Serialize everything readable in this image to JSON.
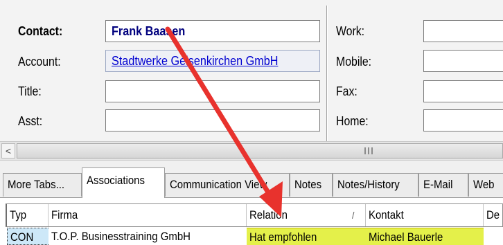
{
  "form": {
    "contact_label": "Contact:",
    "contact_value": "Frank Baasen",
    "account_label": "Account:",
    "account_value": "Stadtwerke Gelsenkirchen GmbH",
    "title_label": "Title:",
    "title_value": "",
    "asst_label": "Asst:",
    "asst_value": "",
    "work_label": "Work:",
    "mobile_label": "Mobile:",
    "fax_label": "Fax:",
    "home_label": "Home:"
  },
  "scrollbar": {
    "left_arrow": "<",
    "grip": "III"
  },
  "tabs": [
    {
      "label": "More Tabs..."
    },
    {
      "label": "Associations",
      "active": true
    },
    {
      "label": "Communication View"
    },
    {
      "label": "Notes"
    },
    {
      "label": "Notes/History"
    },
    {
      "label": "E-Mail"
    },
    {
      "label": "Web"
    }
  ],
  "grid": {
    "columns": [
      "Typ",
      "Firma",
      "Relation",
      "Kontakt",
      "De"
    ],
    "sort_indicator": "/",
    "rows": [
      {
        "typ": "CON",
        "firma": "T.O.P. Businesstraining GmbH",
        "relation": "Hat empfohlen",
        "kontakt": "Michael Bauerle",
        "de": ""
      }
    ]
  },
  "colors": {
    "contact_text": "#00007e",
    "link": "#0000d0",
    "highlight": "#e4f04a",
    "selected_type": "#cde8f8",
    "arrow": "#e8322d"
  }
}
